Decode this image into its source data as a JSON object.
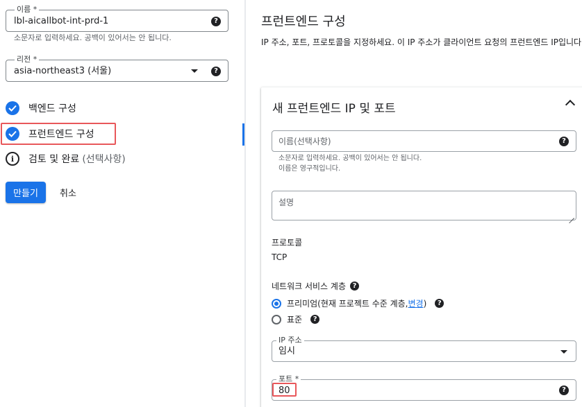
{
  "left": {
    "name_field": {
      "label": "이름 *",
      "value": "lbl-aicallbot-int-prd-1",
      "hint": "소문자로 입력하세요. 공백이 있어서는 안 됩니다."
    },
    "region_field": {
      "label": "리전 *",
      "value": "asia-northeast3 (서울)"
    },
    "steps": [
      {
        "label": "백엔드 구성",
        "status": "complete"
      },
      {
        "label": "프런트엔드 구성",
        "status": "complete"
      },
      {
        "label": "검토 및 완료",
        "optional": "(선택사항)",
        "status": "info"
      }
    ],
    "create_button": "만들기",
    "cancel_button": "취소"
  },
  "right": {
    "title": "프런트엔드 구성",
    "description": "IP 주소, 포트, 프로토콜을 지정하세요. 이 IP 주소가 클라이언트 요청의 프런트엔드 IP입니다.",
    "card": {
      "title": "새 프런트엔드 IP 및 포트",
      "name_placeholder": "이름(선택사항)",
      "name_hint_1": "소문자로 입력하세요. 공백이 있어서는 안 됩니다.",
      "name_hint_2": "이름은 영구적입니다.",
      "description_placeholder": "설명",
      "protocol_label": "프로토콜",
      "protocol_value": "TCP",
      "network_tier_label": "네트워크 서비스 계층",
      "tier_premium": "프리미엄(현재 프로젝트 수준 계층, ",
      "tier_premium_link": "변경",
      "tier_premium_end": ")",
      "tier_standard": "표준",
      "ip_label": "IP 주소",
      "ip_value": "임시",
      "port_label": "포트 *",
      "port_value": "80"
    }
  },
  "icons": {
    "help": "?",
    "info": "i"
  },
  "colors": {
    "accent": "#1a73e8",
    "highlight": "#e8575a"
  }
}
